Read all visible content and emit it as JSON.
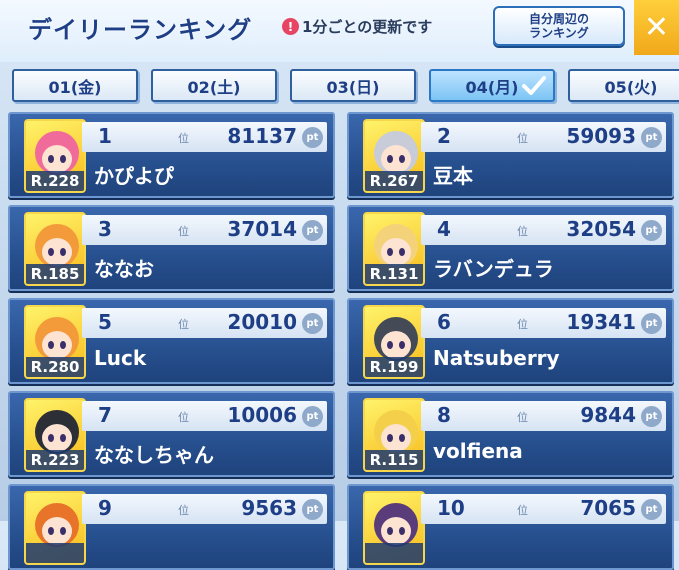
{
  "header": {
    "title": "デイリーランキング",
    "notice": "1分ごとの更新です",
    "nearby_line1": "自分周辺の",
    "nearby_line2": "ランキング",
    "close_symbol": "✕"
  },
  "tabs": [
    {
      "label": "01(金)",
      "active": false
    },
    {
      "label": "02(土)",
      "active": false
    },
    {
      "label": "03(日)",
      "active": false
    },
    {
      "label": "04(月)",
      "active": true
    },
    {
      "label": "05(火)",
      "active": false
    }
  ],
  "rank_suffix": "位",
  "pt_label": "pt",
  "entries": [
    {
      "rank": "1",
      "score": "81137",
      "name": "かぴよぴ",
      "level": "R.228",
      "avatar": "pink-hair-character"
    },
    {
      "rank": "2",
      "score": "59093",
      "name": "豆本",
      "level": "R.267",
      "avatar": "silver-hair-character"
    },
    {
      "rank": "3",
      "score": "37014",
      "name": "ななお",
      "level": "R.185",
      "avatar": "orange-hair-maid-character"
    },
    {
      "rank": "4",
      "score": "32054",
      "name": "ラバンデュラ",
      "level": "R.131",
      "avatar": "blonde-hair-character"
    },
    {
      "rank": "5",
      "score": "20010",
      "name": "Luck",
      "level": "R.280",
      "avatar": "orange-hair-maid-character"
    },
    {
      "rank": "6",
      "score": "19341",
      "name": "Natsuberry",
      "level": "R.199",
      "avatar": "dark-helmet-character"
    },
    {
      "rank": "7",
      "score": "10006",
      "name": "ななしちゃん",
      "level": "R.223",
      "avatar": "black-helmet-character"
    },
    {
      "rank": "8",
      "score": "9844",
      "name": "volfiena",
      "level": "R.115",
      "avatar": "blonde-black-ribbon-character"
    },
    {
      "rank": "9",
      "score": "9563",
      "name": "",
      "level": "",
      "avatar": "orange-character"
    },
    {
      "rank": "10",
      "score": "7065",
      "name": "",
      "level": "",
      "avatar": "purple-hair-character"
    }
  ],
  "colors": {
    "accent": "#1e3f86",
    "card": "#27508f",
    "close": "#f0a81a",
    "notice": "#e64663"
  }
}
